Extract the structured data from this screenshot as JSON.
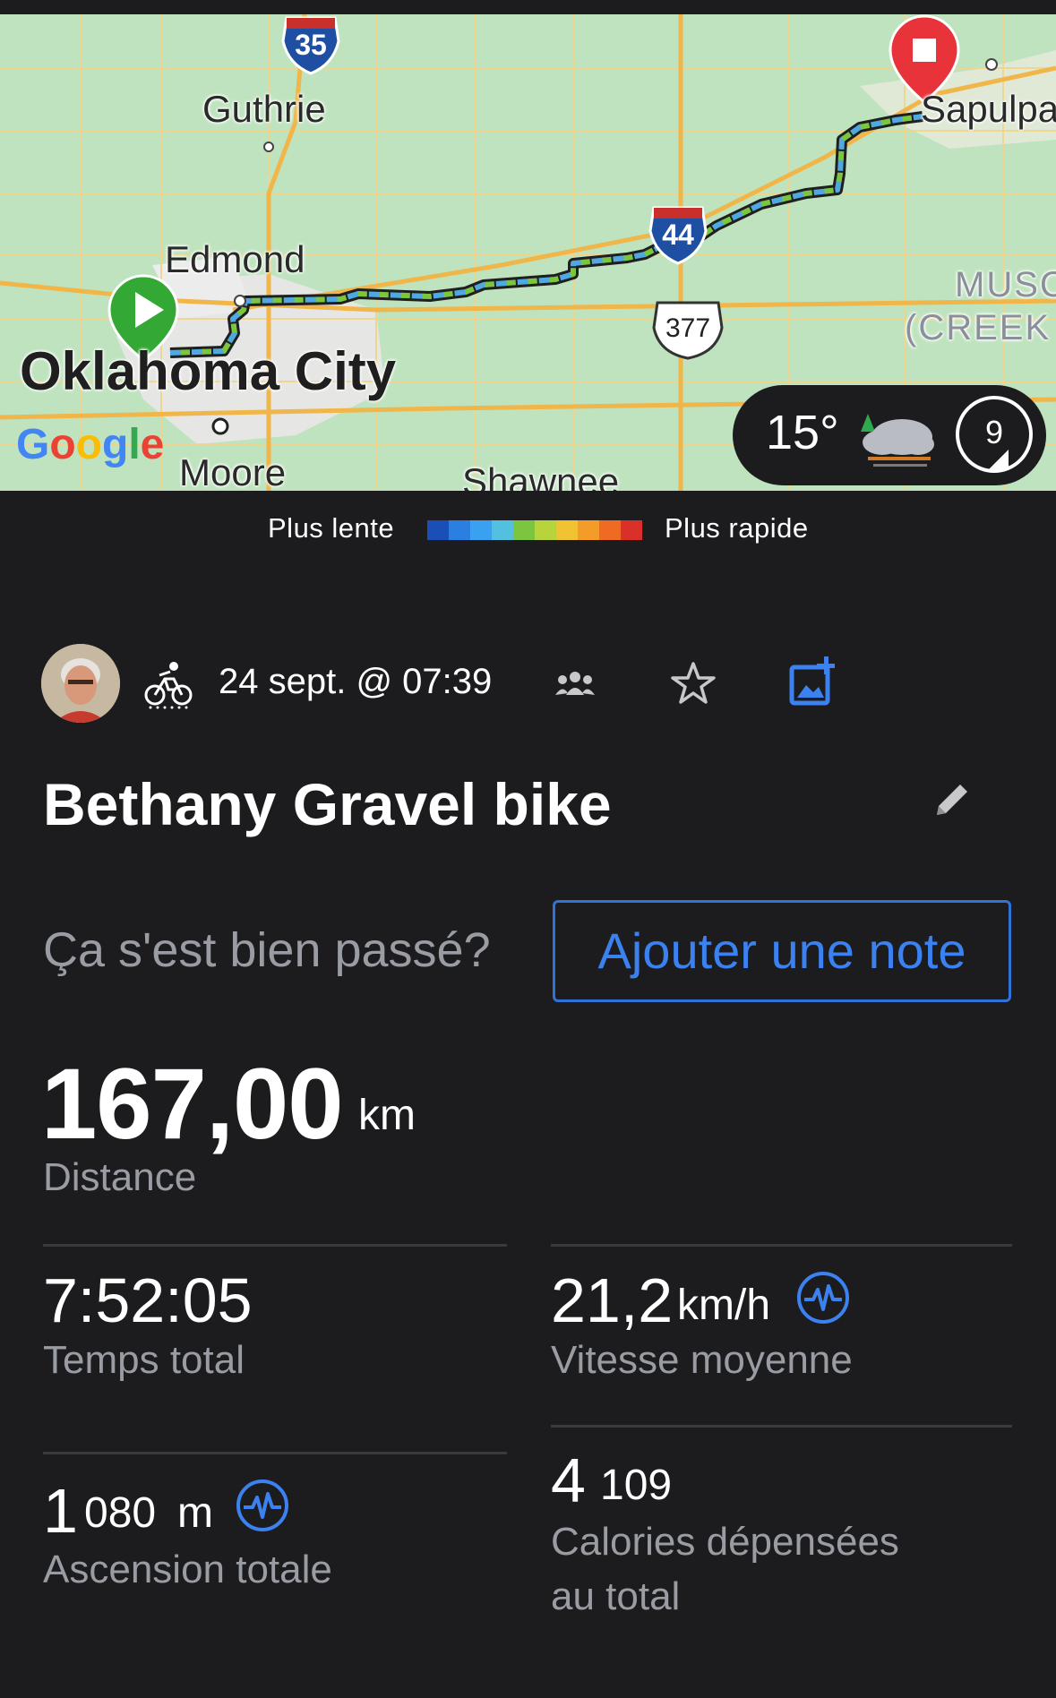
{
  "map": {
    "labels": {
      "guthrie": "Guthrie",
      "edmond": "Edmond",
      "okc": "Oklahoma City",
      "moore": "Moore",
      "shawnee": "Shawnee",
      "sapulpa": "Sapulpa",
      "region_line1": "MUSC",
      "region_line2": "(CREEK",
      "shield_i35": "35",
      "shield_i44": "44",
      "shield_us377": "377",
      "google": "Google"
    },
    "weather": {
      "temperature": "15°",
      "wind": "9",
      "icon": "cloudy-with-tree-icon"
    }
  },
  "legend": {
    "slow": "Plus lente",
    "fast": "Plus rapide",
    "colors": [
      "#1a4fb8",
      "#2a7fe0",
      "#3aa0f0",
      "#53c0e0",
      "#7cc63f",
      "#b7d43c",
      "#f1c232",
      "#f39c2a",
      "#ef6a22",
      "#d9302a"
    ]
  },
  "activity": {
    "type_icon": "cycling-icon",
    "date": "24 sept. @ 07:39",
    "title": "Bethany Gravel bike",
    "question": "Ça s'est bien passé?",
    "add_note": "Ajouter une note"
  },
  "stats": {
    "distance": {
      "value": "167,00",
      "unit": "km",
      "label": "Distance"
    },
    "total_time": {
      "value": "7:52:05",
      "label": "Temps total"
    },
    "avg_speed": {
      "value": "21,2",
      "unit": "km/h",
      "label": "Vitesse moyenne"
    },
    "ascent": {
      "value_main": "1",
      "value_rest": "080",
      "unit": "m",
      "label": "Ascension totale"
    },
    "calories": {
      "value_main": "4",
      "value_rest": "109",
      "label_line1": "Calories dépensées",
      "label_line2": "au total"
    }
  },
  "colors": {
    "accent": "#2f73d8",
    "background": "#1c1c1e",
    "muted": "#9a9ca3"
  }
}
